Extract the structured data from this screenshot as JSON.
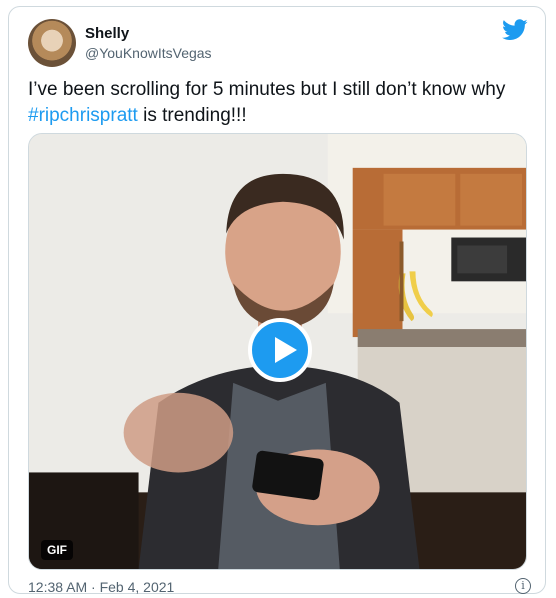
{
  "tweet": {
    "author_name": "Shelly",
    "author_handle": "@YouKnowItsVegas",
    "text_before": "I’ve been scrolling for 5 minutes but I still don’t know why ",
    "hashtag": "#ripchrispratt",
    "text_after": " is trending!!!",
    "timestamp": "12:38 AM · Feb 4, 2021"
  },
  "media": {
    "badge": "GIF",
    "play_icon": "play-icon"
  },
  "icons": {
    "brand": "twitter-bird-icon",
    "info": "info-icon"
  },
  "colors": {
    "accent": "#1d9bf0",
    "text": "#0f1419",
    "secondary": "#536471"
  }
}
